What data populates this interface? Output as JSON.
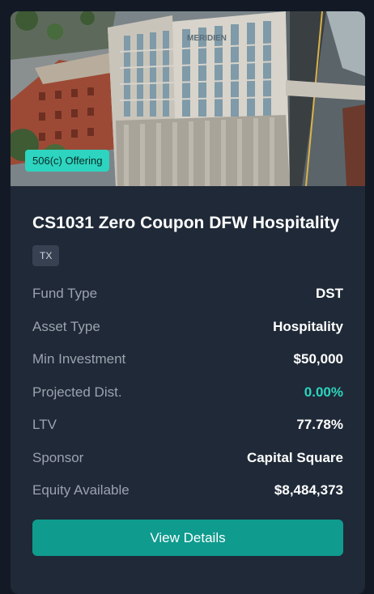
{
  "listing": {
    "image_sign_text": "MERIDIEN",
    "offering_badge": "506(c) Offering",
    "title": "CS1031 Zero Coupon DFW Hospitality",
    "state": "TX",
    "details": [
      {
        "label": "Fund Type",
        "value": "DST",
        "highlight": false
      },
      {
        "label": "Asset Type",
        "value": "Hospitality",
        "highlight": false
      },
      {
        "label": "Min Investment",
        "value": "$50,000",
        "highlight": false
      },
      {
        "label": "Projected Dist.",
        "value": "0.00%",
        "highlight": true
      },
      {
        "label": "LTV",
        "value": "77.78%",
        "highlight": false
      },
      {
        "label": "Sponsor",
        "value": "Capital Square",
        "highlight": false
      },
      {
        "label": "Equity Available",
        "value": "$8,484,373",
        "highlight": false
      }
    ],
    "cta_label": "View Details",
    "colors": {
      "background": "#131a26",
      "card": "#1f2937",
      "accent": "#2dd4bf",
      "button": "#0f9b8e"
    }
  }
}
